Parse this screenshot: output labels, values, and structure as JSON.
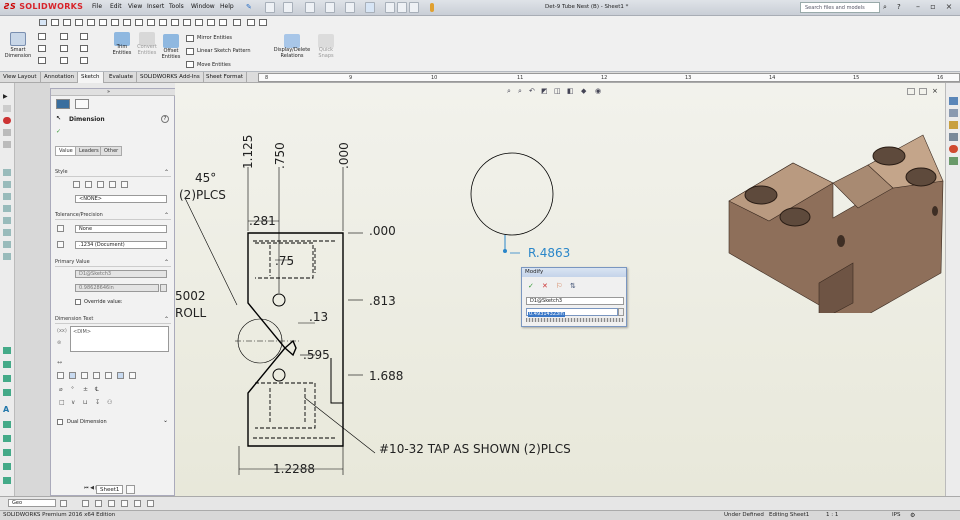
{
  "app": {
    "logo": "SOLIDWORKS",
    "document_title": "Det-9 Tube Nest (B) - Sheet1 *",
    "search_placeholder": "Search files and models"
  },
  "menu": [
    "File",
    "Edit",
    "View",
    "Insert",
    "Tools",
    "Window",
    "Help"
  ],
  "commands": {
    "smart_dimension": "Smart Dimension",
    "trim_entities": "Trim Entities",
    "convert_entities": "Convert Entities",
    "offset_entities": "Offset Entities",
    "mirror_entities": "Mirror Entities",
    "linear_sketch_pattern": "Linear Sketch Pattern",
    "move_entities": "Move Entities",
    "display_delete_relations": "Display/Delete Relations",
    "quick_snaps": "Quick Snaps"
  },
  "tabs": [
    "View Layout",
    "Annotation",
    "Sketch",
    "Evaluate",
    "SOLIDWORKS Add-Ins",
    "Sheet Format"
  ],
  "active_tab": "Sketch",
  "ruler_numbers": [
    "8",
    "9",
    "10",
    "11",
    "12",
    "13",
    "14",
    "15",
    "16"
  ],
  "property_manager": {
    "title": "Dimension",
    "help": "?",
    "tabs": [
      "Value",
      "Leaders",
      "Other"
    ],
    "style_label": "Style",
    "style_value": "<NONE>",
    "tolerance_label": "Tolerance/Precision",
    "tolerance_value": "None",
    "precision_value": ".1234 (Document)",
    "primary_value_label": "Primary Value",
    "primary_value_name": "D1@Sketch3",
    "primary_value_value": "0.98628646in",
    "override_label": "Override value:",
    "dimension_text_label": "Dimension Text",
    "dimension_text_value": "<DIM>",
    "dual_dimension_label": "Dual Dimension"
  },
  "drawing": {
    "dims": {
      "d_1125": "1.125",
      "d_750": ".750",
      "d_000v": ".000",
      "angle": "45°",
      "two_plcs": "(2)PLCS",
      "d_281": ".281",
      "d_000h": ".000",
      "d_75": ".75",
      "d_5002": "5002",
      "roll": "ROLL",
      "d_813": ".813",
      "d_13": ".13",
      "d_595": ".595",
      "d_1688": "1.688",
      "tap_note": "#10-32 TAP AS SHOWN (2)PLCS",
      "d_12288": "1.2288",
      "radius": "R.4863"
    }
  },
  "modify": {
    "title": "Modify",
    "name": "D1@Sketch3",
    "value": "0.49314323in"
  },
  "bottom": {
    "layer_value": "Geo",
    "sheet_tab": "Sheet1"
  },
  "status": {
    "edition": "SOLIDWORKS Premium 2016 x64 Edition",
    "definition": "Under Defined",
    "editing": "Editing Sheet1",
    "scale": "1 : 1",
    "units": "IPS"
  }
}
